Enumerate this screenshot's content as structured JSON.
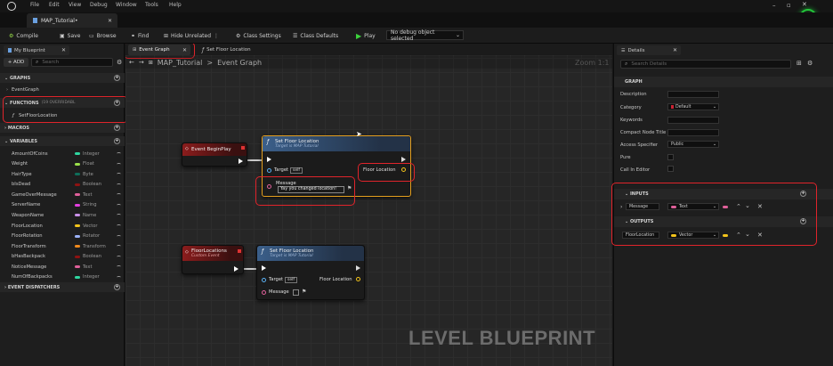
{
  "menu": [
    "File",
    "Edit",
    "View",
    "Debug",
    "Window",
    "Tools",
    "Help"
  ],
  "doc_tab": "MAP_Tutorial•",
  "toolbar": {
    "compile": "Compile",
    "save": "Save",
    "browse": "Browse",
    "find": "Find",
    "hide_unrelated": "Hide Unrelated",
    "class_settings": "Class Settings",
    "class_defaults": "Class Defaults",
    "play": "Play",
    "debug_object": "No debug object selected"
  },
  "left": {
    "tab": "My Blueprint",
    "add": "+ ADD",
    "search_placeholder": "Search",
    "graphs_hdr": "GRAPHS",
    "event_graph": "EventGraph",
    "functions_hdr": "FUNCTIONS",
    "functions_override": "(19 OVERRIDABL",
    "function_item": "SetFloorLocation",
    "macros_hdr": "MACROS",
    "variables_hdr": "VARIABLES",
    "dispatchers_hdr": "EVENT DISPATCHERS",
    "variables": [
      {
        "name": "AmountOfCoins",
        "type": "Integer",
        "color": "#2fd6a0"
      },
      {
        "name": "Weight",
        "type": "Float",
        "color": "#9be04a"
      },
      {
        "name": "HairType",
        "type": "Byte",
        "color": "#0f6e5a"
      },
      {
        "name": "bIsDead",
        "type": "Boolean",
        "color": "#8e1212"
      },
      {
        "name": "GameOverMessage",
        "type": "Text",
        "color": "#e0609a"
      },
      {
        "name": "ServerName",
        "type": "String",
        "color": "#e43ee0"
      },
      {
        "name": "WeaponName",
        "type": "Name",
        "color": "#c990e8"
      },
      {
        "name": "FloorLocation",
        "type": "Vector",
        "color": "#f3c41b"
      },
      {
        "name": "FloorRotation",
        "type": "Rotator",
        "color": "#9bb1f7"
      },
      {
        "name": "FloorTransform",
        "type": "Transform",
        "color": "#f08a1c"
      },
      {
        "name": "bHasBackpack",
        "type": "Boolean",
        "color": "#8e1212"
      },
      {
        "name": "NoticeMessage",
        "type": "Text",
        "color": "#e0609a"
      },
      {
        "name": "NumOfBackpacks",
        "type": "Integer",
        "color": "#2fd6a0"
      }
    ]
  },
  "graph": {
    "tab_event": "Event Graph",
    "tab_func": "Set Floor Location",
    "breadcrumb_root": "MAP_Tutorial",
    "breadcrumb_sep": ">",
    "breadcrumb_leaf": "Event Graph",
    "zoom": "Zoom 1:1",
    "watermark": "LEVEL BLUEPRINT",
    "node_begin": "Event BeginPlay",
    "node_set1_title": "Set Floor Location",
    "node_set1_sub": "Target is MAP Tutorial",
    "target": "Target",
    "self": "self",
    "floor_location": "Floor Location",
    "message": "Message",
    "message_value": "Yay you changed location!",
    "node_custom": "FloorLocations",
    "node_custom_sub": "Custom Event",
    "node_set2_title": "Set Floor Location",
    "node_set2_sub": "Target is MAP Tutorial"
  },
  "details": {
    "tab": "Details",
    "search_placeholder": "Search Details",
    "graph_hdr": "GRAPH",
    "rows": [
      "Description",
      "Category",
      "Keywords",
      "Compact Node Title",
      "Access Specifier",
      "Pure",
      "Call In Editor"
    ],
    "category_value": "Default",
    "access_value": "Public",
    "inputs_hdr": "INPUTS",
    "input_name": "Message",
    "input_type": "Text",
    "outputs_hdr": "OUTPUTS",
    "output_name": "FloorLocation",
    "output_type": "Vector"
  }
}
